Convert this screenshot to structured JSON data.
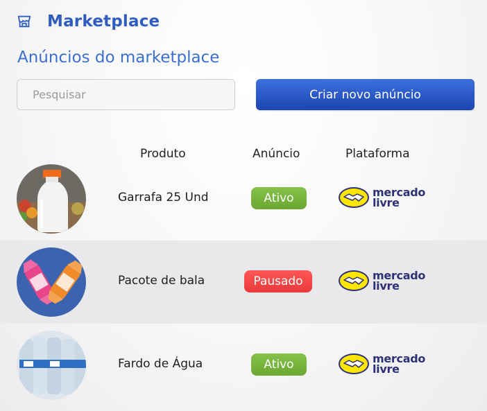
{
  "header": {
    "title": "Marketplace",
    "icon": "store-icon"
  },
  "section": {
    "title": "Anúncios do marketplace"
  },
  "search": {
    "placeholder": "Pesquisar",
    "value": ""
  },
  "actions": {
    "create_label": "Criar novo anúncio"
  },
  "table": {
    "columns": {
      "product": "Produto",
      "ad": "Anúncio",
      "platform": "Plataforma"
    },
    "rows": [
      {
        "product": "Garrafa 25 Und",
        "status": "Ativo",
        "status_color": "#7ab83f",
        "platform_line1": "mercado",
        "platform_line2": "livre",
        "image": "milk-bottle-photo"
      },
      {
        "product": "Pacote de bala",
        "status": "Pausado",
        "status_color": "#f04545",
        "platform_line1": "mercado",
        "platform_line2": "livre",
        "image": "candy-photo"
      },
      {
        "product": "Fardo de Água",
        "status": "Ativo",
        "status_color": "#7ab83f",
        "platform_line1": "mercado",
        "platform_line2": "livre",
        "image": "water-bottles-photo"
      }
    ]
  },
  "colors": {
    "primary": "#2f5dbf",
    "button": "#2a57c8",
    "active": "#7ab83f",
    "paused": "#f04545",
    "alt_row": "#e9e9eb"
  }
}
